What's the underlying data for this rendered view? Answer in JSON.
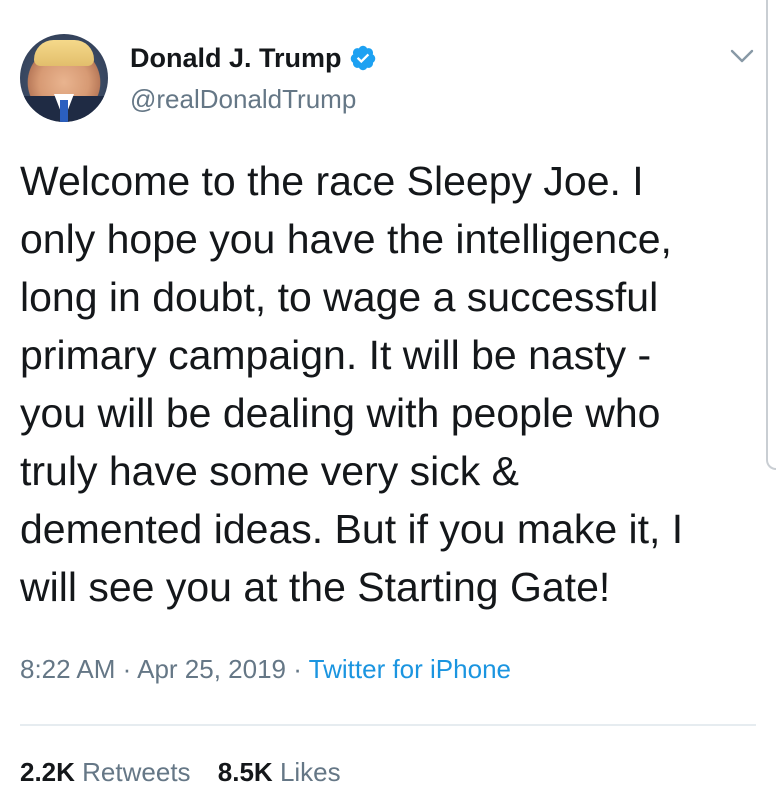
{
  "tweet": {
    "author": {
      "display_name": "Donald J. Trump",
      "handle": "@realDonaldTrump",
      "verified_icon": "verified-badge-icon",
      "avatar": "profile-photo"
    },
    "menu_icon": "chevron-down-icon",
    "text_lines": [
      "Welcome to the race Sleepy Joe. I",
      "only hope you have the intelligence,",
      "long in doubt, to wage a successful",
      "primary campaign. It will be nasty -",
      "you will be dealing with people who",
      "truly have some very sick &",
      "demented ideas. But if you make it, I",
      "will see you at the Starting Gate!"
    ],
    "time": "8:22 AM",
    "date": "Apr 25, 2019",
    "separator": "·",
    "source": "Twitter for iPhone",
    "stats": {
      "retweets_count": "2.2K",
      "retweets_label": "Retweets",
      "likes_count": "8.5K",
      "likes_label": "Likes"
    }
  },
  "colors": {
    "text": "#14171a",
    "secondary": "#657786",
    "link": "#1b95e0",
    "verified": "#1da1f2",
    "divider": "#e6ecf0"
  }
}
